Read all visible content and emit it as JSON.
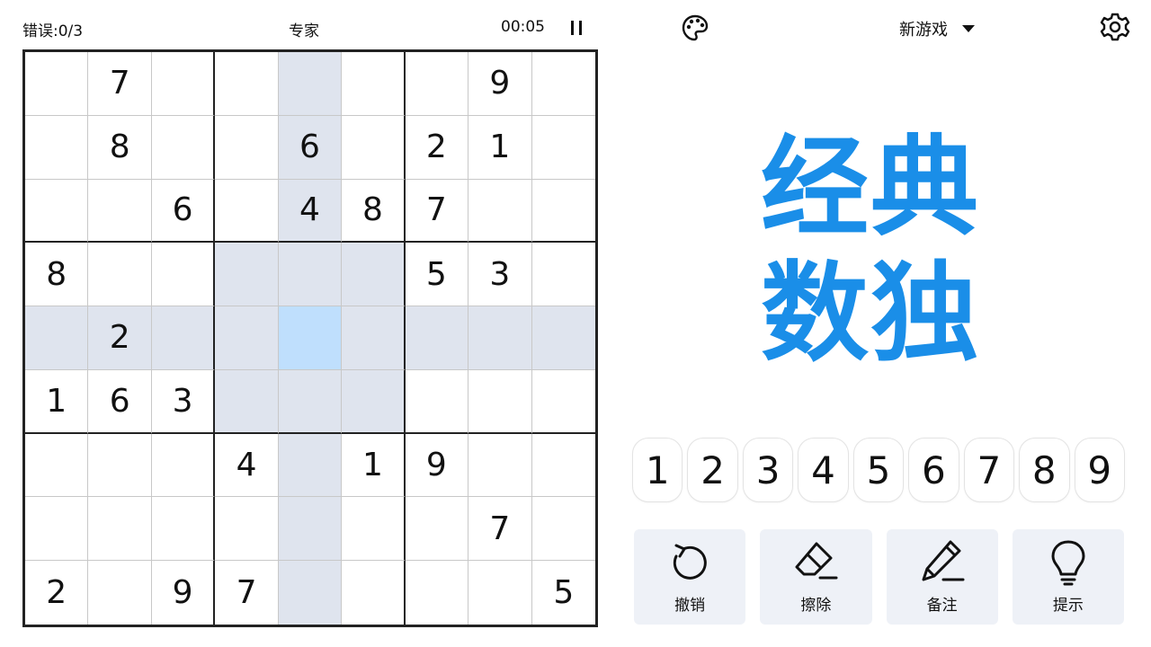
{
  "header": {
    "mistakes": "错误:0/3",
    "difficulty": "专家",
    "timer": "00:05",
    "new_game_label": "新游戏"
  },
  "icons": {
    "pause": "pause-icon",
    "palette": "palette-icon",
    "dropdown": "caret-down-icon",
    "settings": "gear-icon",
    "undo": "undo-icon",
    "erase": "eraser-icon",
    "notes": "pencil-icon",
    "hint": "lightbulb-icon"
  },
  "colors": {
    "accent": "#1a8ee8",
    "highlight": "#dfe4ee",
    "selected": "#bfdffd",
    "tool_bg": "#eef1f7"
  },
  "title": {
    "line1": "经典",
    "line2": "数独"
  },
  "board": {
    "selected": [
      4,
      4
    ],
    "grid": [
      [
        "",
        "7",
        "",
        "",
        "",
        "",
        "",
        "9",
        ""
      ],
      [
        "",
        "8",
        "",
        "",
        "6",
        "",
        "2",
        "1",
        ""
      ],
      [
        "",
        "",
        "6",
        "",
        "4",
        "8",
        "7",
        "",
        ""
      ],
      [
        "8",
        "",
        "",
        "",
        "",
        "",
        "5",
        "3",
        ""
      ],
      [
        "",
        "2",
        "",
        "",
        "",
        "",
        "",
        "",
        ""
      ],
      [
        "1",
        "6",
        "3",
        "",
        "",
        "",
        "",
        "",
        ""
      ],
      [
        "",
        "",
        "",
        "4",
        "",
        "1",
        "9",
        "",
        ""
      ],
      [
        "",
        "",
        "",
        "",
        "",
        "",
        "",
        "7",
        ""
      ],
      [
        "2",
        "",
        "9",
        "7",
        "",
        "",
        "",
        "",
        "5"
      ]
    ]
  },
  "numpad": [
    "1",
    "2",
    "3",
    "4",
    "5",
    "6",
    "7",
    "8",
    "9"
  ],
  "tools": {
    "undo": "撤销",
    "erase": "擦除",
    "notes": "备注",
    "hint": "提示"
  }
}
